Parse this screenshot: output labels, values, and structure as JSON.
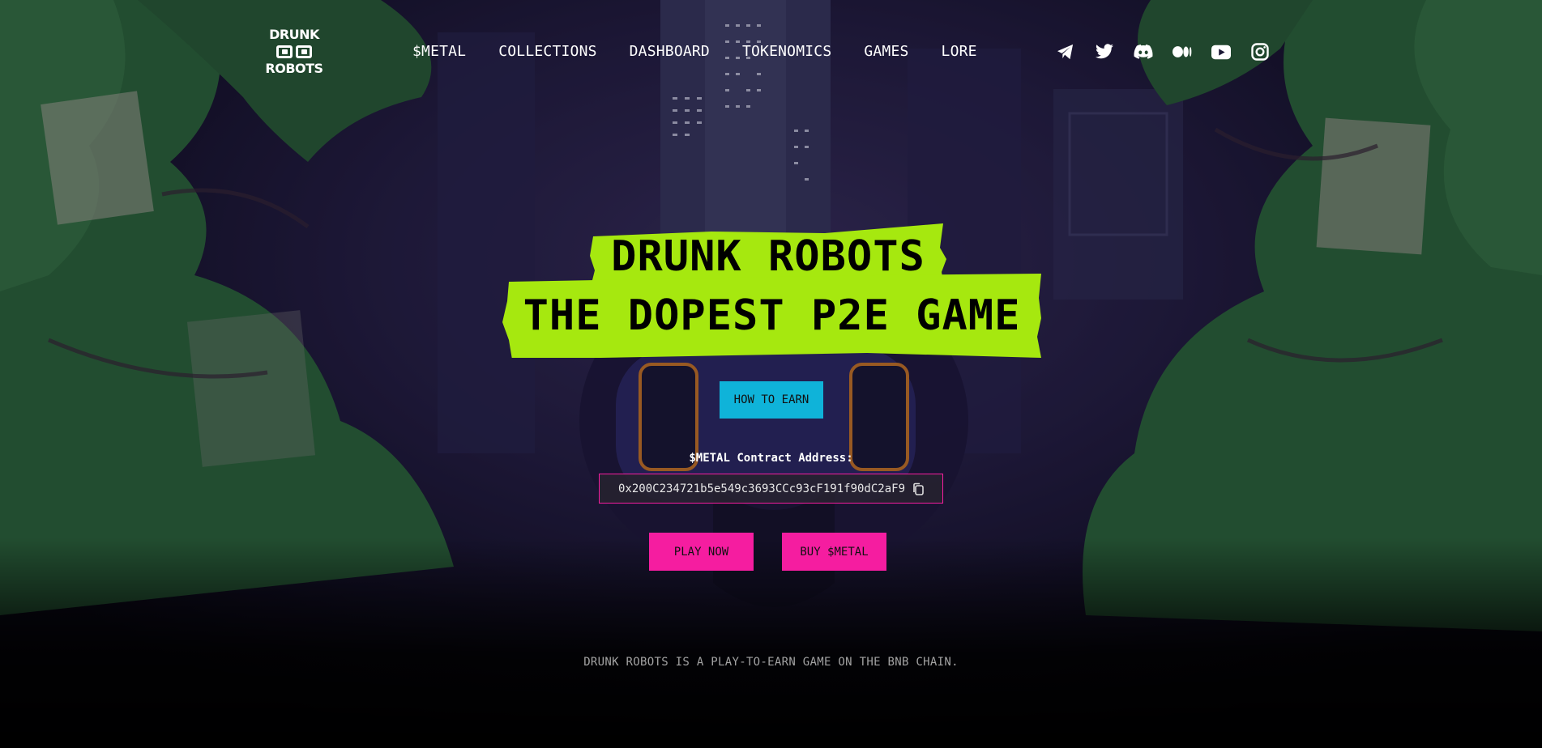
{
  "logo": {
    "line1": "DRUNK",
    "line2": "ROBOTS"
  },
  "nav": {
    "items": [
      {
        "label": "$METAL"
      },
      {
        "label": "COLLECTIONS"
      },
      {
        "label": "DASHBOARD"
      },
      {
        "label": "TOKENOMICS"
      },
      {
        "label": "GAMES"
      },
      {
        "label": "LORE"
      }
    ]
  },
  "socials": [
    "telegram-icon",
    "twitter-icon",
    "discord-icon",
    "medium-icon",
    "youtube-icon",
    "instagram-icon"
  ],
  "hero": {
    "title_line1": "DRUNK ROBOTS",
    "title_line2": "THE DOPEST P2E GAME",
    "how_to_earn": "HOW TO EARN",
    "contract_label": "$METAL Contract Address:",
    "contract_address": "0x200C234721b5e549c3693CCc93cF191f90dC2aF9",
    "play_now": "PLAY NOW",
    "buy_metal": "BUY $METAL",
    "tagline": "DRUNK ROBOTS IS A PLAY-TO-EARN GAME ON THE BNB CHAIN."
  },
  "colors": {
    "title_bg": "#a6e80f",
    "earn_button": "#0fb3d9",
    "pink_button": "#f51da0",
    "foliage": "#2f6a3e"
  }
}
